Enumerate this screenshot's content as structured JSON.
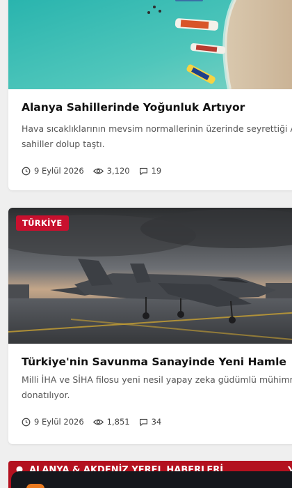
{
  "articles": [
    {
      "title": "Alanya Sahillerinde Yoğunluk Artıyor",
      "excerpt_line1": "Hava sıcaklıklarının mevsim normallerinin üzerinde seyrettiği Alanya'da",
      "excerpt_line2": "sahiller dolup taştı.",
      "date": "9 Eylül 2026",
      "views": "3,120",
      "comments": "19"
    },
    {
      "badge": "TÜRKİYE",
      "title": "Türkiye'nin Savunma Sanayinde Yeni Hamle",
      "excerpt_line1": "Milli İHA ve SİHA filosu yeni nesil yapay zeka güdümlü mühimmatla",
      "excerpt_line2": "donatılıyor.",
      "date": "9 Eylül 2026",
      "views": "1,851",
      "comments": "34"
    }
  ],
  "section": {
    "title": "ALANYA & AKDENİZ YEREL HABERLERİ"
  },
  "colors": {
    "accent": "#c8102e",
    "section_bar": "#b3111f",
    "dock": "#15171c"
  },
  "icons": [
    "clock-icon",
    "eye-icon",
    "comment-icon",
    "pin-icon",
    "chevron-right-icon"
  ]
}
